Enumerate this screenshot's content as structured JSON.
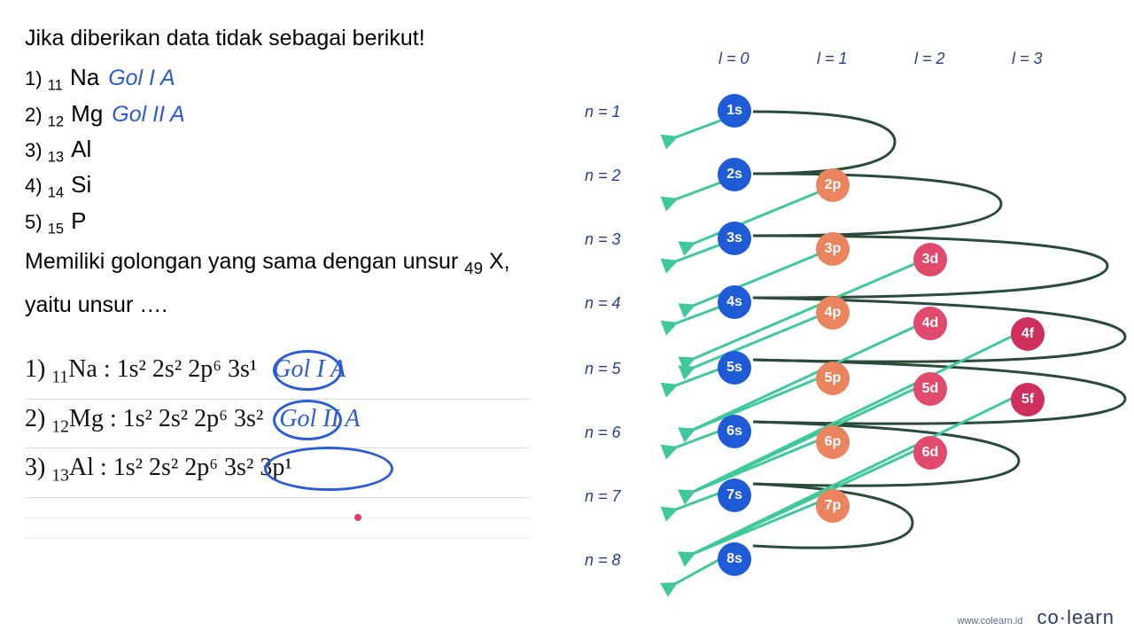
{
  "question": {
    "intro": "Jika diberikan data tidak sebagai berikut!",
    "items": [
      {
        "num": "1)",
        "sub": "11",
        "sym": "Na",
        "gol": "Gol I A"
      },
      {
        "num": "2)",
        "sub": "12",
        "sym": "Mg",
        "gol": "Gol II A"
      },
      {
        "num": "3)",
        "sub": "13",
        "sym": "Al",
        "gol": ""
      },
      {
        "num": "4)",
        "sub": "14",
        "sym": "Si",
        "gol": ""
      },
      {
        "num": "5)",
        "sub": "15",
        "sym": "P",
        "gol": ""
      }
    ],
    "closing_a": "Memiliki golongan yang sama dengan unsur ",
    "closing_sub": "49",
    "closing_b": " X, yaitu unsur …."
  },
  "work": [
    {
      "num": "1)",
      "sub": "11",
      "el": "Na",
      "cfg": "1s² 2s² 2p⁶ 3s¹",
      "gol": "Gol I A"
    },
    {
      "num": "2)",
      "sub": "12",
      "el": "Mg",
      "cfg": "1s² 2s² 2p⁶ 3s²",
      "gol": "Gol II A"
    },
    {
      "num": "3)",
      "sub": "13",
      "el": "Al",
      "cfg": "1s² 2s² 2p⁶ 3s² 3p¹",
      "gol": ""
    }
  ],
  "diagram": {
    "l_headers": [
      "l = 0",
      "l = 1",
      "l = 2",
      "l = 3"
    ],
    "n_labels": [
      "n = 1",
      "n = 2",
      "n = 3",
      "n = 4",
      "n = 5",
      "n = 6",
      "n = 7",
      "n = 8"
    ],
    "orbitals": [
      {
        "label": "1s",
        "col": 0,
        "row": 0,
        "color": "blue"
      },
      {
        "label": "2s",
        "col": 0,
        "row": 1,
        "color": "blue"
      },
      {
        "label": "2p",
        "col": 1,
        "row": 1,
        "color": "orange"
      },
      {
        "label": "3s",
        "col": 0,
        "row": 2,
        "color": "blue"
      },
      {
        "label": "3p",
        "col": 1,
        "row": 2,
        "color": "orange"
      },
      {
        "label": "3d",
        "col": 2,
        "row": 2,
        "color": "pink"
      },
      {
        "label": "4s",
        "col": 0,
        "row": 3,
        "color": "blue"
      },
      {
        "label": "4p",
        "col": 1,
        "row": 3,
        "color": "orange"
      },
      {
        "label": "4d",
        "col": 2,
        "row": 3,
        "color": "pink"
      },
      {
        "label": "4f",
        "col": 3,
        "row": 3,
        "color": "magenta"
      },
      {
        "label": "5s",
        "col": 0,
        "row": 4,
        "color": "blue"
      },
      {
        "label": "5p",
        "col": 1,
        "row": 4,
        "color": "orange"
      },
      {
        "label": "5d",
        "col": 2,
        "row": 4,
        "color": "pink"
      },
      {
        "label": "5f",
        "col": 3,
        "row": 4,
        "color": "magenta"
      },
      {
        "label": "6s",
        "col": 0,
        "row": 5,
        "color": "blue"
      },
      {
        "label": "6p",
        "col": 1,
        "row": 5,
        "color": "orange"
      },
      {
        "label": "6d",
        "col": 2,
        "row": 5,
        "color": "pink"
      },
      {
        "label": "7s",
        "col": 0,
        "row": 6,
        "color": "blue"
      },
      {
        "label": "7p",
        "col": 1,
        "row": 6,
        "color": "orange"
      },
      {
        "label": "8s",
        "col": 0,
        "row": 7,
        "color": "blue"
      }
    ]
  },
  "footer": {
    "url": "www.colearn.id",
    "brand_a": "co",
    "brand_dot": "·",
    "brand_b": "learn"
  }
}
